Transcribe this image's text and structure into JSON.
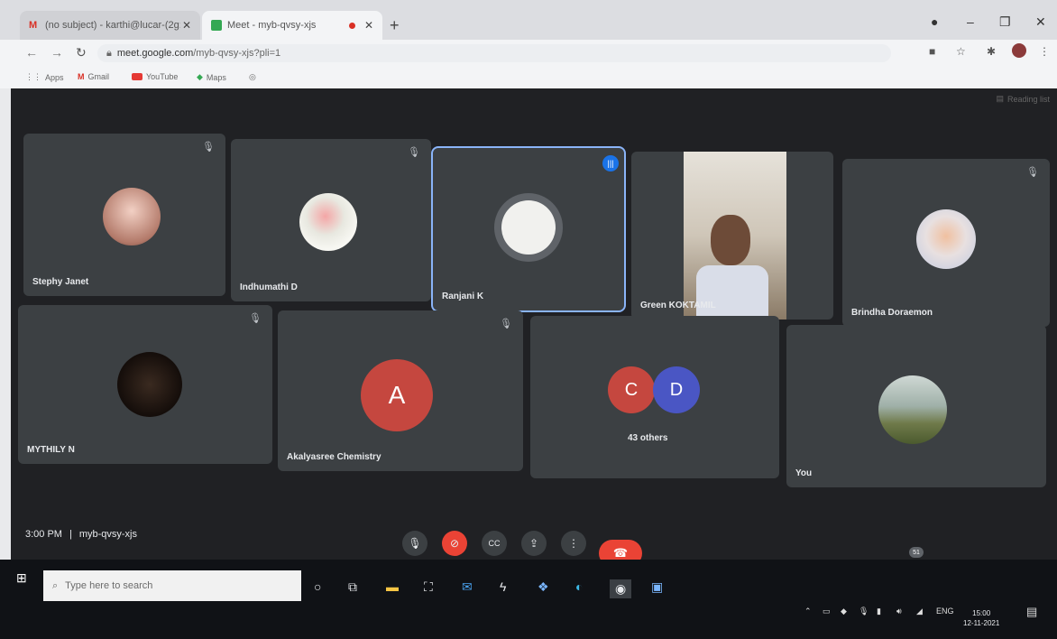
{
  "browser": {
    "tabs": [
      {
        "title": "(no subject) - karthi@lucar-(2g::",
        "active": false
      },
      {
        "title": "Meet - myb-qvsy-xjs",
        "active": true
      }
    ],
    "url_host": "meet.google.com",
    "url_path": "/myb-qvsy-xjs?pli=1",
    "bookmarks": [
      "Apps",
      "Gmail",
      "YouTube",
      "Maps"
    ],
    "reading_list": "Reading list"
  },
  "meet": {
    "participants": [
      {
        "name": "Stephy Janet"
      },
      {
        "name": "Indhumathi D"
      },
      {
        "name": "Ranjani K"
      },
      {
        "name": "Green KOKTAMIL"
      },
      {
        "name": "Brindha Doraemon"
      },
      {
        "name": "MYTHILY N"
      },
      {
        "name": "Akalyasree Chemistry",
        "initial": "A"
      },
      {
        "name": "43 others",
        "initials": [
          "C",
          "D"
        ]
      },
      {
        "name": "You"
      }
    ],
    "time": "3:00 PM",
    "meeting_code": "myb-qvsy-xjs",
    "people_count": "51"
  },
  "taskbar": {
    "search_placeholder": "Type here to search",
    "language": "ENG",
    "clock_time": "15:00",
    "clock_date": "12-11-2021"
  },
  "colors": {
    "accent": "#1a73e8",
    "danger": "#ea4335",
    "tile": "#3c4043",
    "bg": "#202124"
  }
}
